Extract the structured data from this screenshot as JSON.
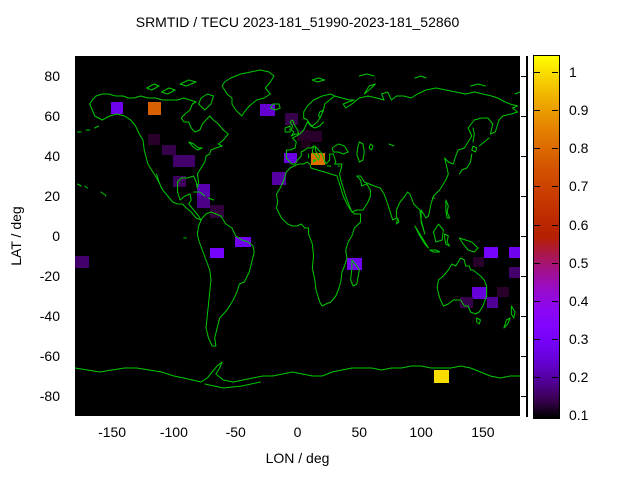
{
  "title": "SRMTID / TECU 2023-181_51990-2023-181_52860",
  "axes": {
    "x": {
      "label": "LON / deg",
      "ticks": [
        -150,
        -100,
        -50,
        0,
        50,
        100,
        150
      ],
      "range": [
        -180,
        180
      ]
    },
    "y": {
      "label": "LAT / deg",
      "ticks": [
        80,
        60,
        40,
        20,
        0,
        -20,
        -40,
        -60,
        -80
      ],
      "range": [
        -90,
        90
      ]
    },
    "colorbar": {
      "ticks": [
        1,
        0.9,
        0.8,
        0.7,
        0.6,
        0.5,
        0.4,
        0.3,
        0.2,
        0.1
      ],
      "range": [
        0.095,
        1.045
      ],
      "palette": "gnuplot black-violet-red-yellow"
    }
  },
  "colors": {
    "page_background": "#ffffff",
    "plot_background": "#000000",
    "coastline": "#00c800",
    "text": "#000000"
  },
  "chart_data": {
    "type": "heatmap",
    "title": "SRMTID / TECU 2023-181_51990-2023-181_52860",
    "xlabel": "LON / deg",
    "ylabel": "LAT / deg",
    "xlim": [
      -180,
      180
    ],
    "ylim": [
      -90,
      90
    ],
    "colorbar_lim": [
      0.1,
      1.0
    ],
    "colorbar_unit": "TECU",
    "cell_columns": [
      "lon_min",
      "lon_max",
      "lat_min",
      "lat_max",
      "tecu_value"
    ],
    "cells": [
      [
        -151,
        -141,
        61,
        67,
        0.27
      ],
      [
        -121,
        -110,
        60.5,
        67,
        0.78
      ],
      [
        -121,
        -111,
        45.5,
        51,
        0.12
      ],
      [
        -110,
        -98,
        40.5,
        45.5,
        0.14
      ],
      [
        -101,
        -83,
        34.5,
        40.5,
        0.16
      ],
      [
        -101,
        -90,
        24.5,
        30,
        0.15
      ],
      [
        -81,
        -71,
        20,
        26,
        0.21
      ],
      [
        -81,
        -71,
        14,
        20,
        0.18
      ],
      [
        -71,
        -59,
        9,
        15.5,
        0.13
      ],
      [
        -51,
        -38,
        -5.5,
        -0.5,
        0.28
      ],
      [
        -71,
        -59,
        -11,
        -6,
        0.3
      ],
      [
        -180,
        -169,
        -16,
        -10,
        0.16
      ],
      [
        -30,
        -18,
        60,
        66,
        0.24
      ],
      [
        -10,
        0.5,
        55.5,
        61.5,
        0.14
      ],
      [
        -0.5,
        10,
        47.5,
        53,
        0.12
      ],
      [
        10,
        20,
        47,
        52.5,
        0.12
      ],
      [
        3,
        11,
        44,
        48,
        0.11
      ],
      [
        -11,
        -0.5,
        36.5,
        41.5,
        0.26
      ],
      [
        11,
        22,
        35.5,
        41.5,
        0.82
      ],
      [
        -21,
        -9,
        25.5,
        32,
        0.2
      ],
      [
        40,
        52,
        -17,
        -11,
        0.28
      ],
      [
        151,
        162,
        -11,
        -5.5,
        0.3
      ],
      [
        171,
        180,
        -11,
        -5.5,
        0.28
      ],
      [
        142,
        151,
        -15.5,
        -10.5,
        0.12
      ],
      [
        171,
        180,
        -21,
        -15.5,
        0.16
      ],
      [
        141,
        153,
        -31.5,
        -25.5,
        0.25
      ],
      [
        161,
        171,
        -30.5,
        -25.5,
        0.12
      ],
      [
        131.5,
        142,
        -36,
        -30.5,
        0.14
      ],
      [
        153,
        162,
        -36,
        -30.5,
        0.19
      ],
      [
        110,
        122.5,
        -73.5,
        -67,
        1.0
      ]
    ]
  }
}
